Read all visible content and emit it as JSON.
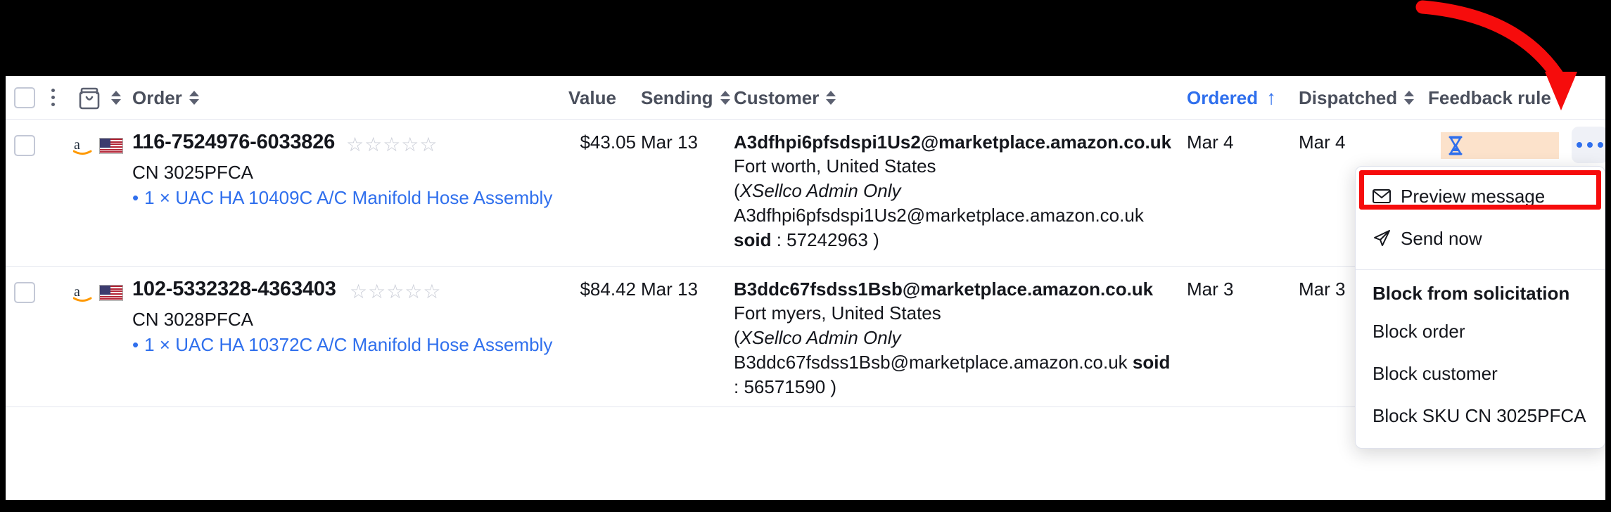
{
  "app": {
    "accent_blue": "#2f6fed",
    "highlight_red": "#f60c0c",
    "badge_peach": "#fce2cb"
  },
  "table": {
    "headers": {
      "checkbox": "",
      "kebab": "",
      "bag_icon": "shopping-bag-icon",
      "order": "Order",
      "value": "Value",
      "sending": "Sending",
      "customer": "Customer",
      "ordered": "Ordered",
      "dispatched": "Dispatched",
      "feedback_rule": "Feedback rule"
    },
    "sort": {
      "active_column": "Ordered",
      "direction": "↑"
    },
    "rows": [
      {
        "marketplace_icon": "amazon-icon",
        "country_flag": "us-flag-icon",
        "order_number": "116-7524976-6033826",
        "stars": "☆☆☆☆☆",
        "sku": "CN 3025PFCA",
        "item_line": "1 × UAC HA 10409C A/C Manifold Hose Assembly",
        "value": "$43.05",
        "sending": "Mar 13",
        "customer_email": "A3dfhpi6pfsdspi1Us2@marketplace.amazon.co.uk",
        "customer_location": "Fort worth, United States",
        "admin_note_open": "(",
        "admin_note_label": "XSellco Admin Only",
        "admin_detail_email": "A3dfhpi6pfsdspi1Us2@marketplace.amazon.co.uk",
        "soid_label": "soid",
        "soid_separator": ":",
        "soid_value": "57242963",
        "admin_note_close": ")",
        "ordered": "Mar 4",
        "dispatched": "Mar 4",
        "feedback_rule_icon": "hourglass-icon"
      },
      {
        "marketplace_icon": "amazon-icon",
        "country_flag": "us-flag-icon",
        "order_number": "102-5332328-4363403",
        "stars": "☆☆☆☆☆",
        "sku": "CN 3028PFCA",
        "item_line": "1 × UAC HA 10372C A/C Manifold Hose Assembly",
        "value": "$84.42",
        "sending": "Mar 13",
        "customer_email": "B3ddc67fsdss1Bsb@marketplace.amazon.co.uk",
        "customer_location": "Fort myers, United States",
        "admin_note_open": "(",
        "admin_note_label": "XSellco Admin Only",
        "admin_detail_email": "B3ddc67fsdss1Bsb@marketplace.amazon.co.uk",
        "soid_label": "soid",
        "soid_separator": ":",
        "soid_value": "56571590",
        "admin_note_close": ")",
        "ordered": "Mar 3",
        "dispatched": "Mar 3",
        "feedback_rule_icon": ""
      }
    ]
  },
  "context_menu": {
    "items": [
      {
        "label": "Preview message",
        "icon": "envelope-icon",
        "highlighted": true
      },
      {
        "label": "Send now",
        "icon": "send-paper-plane-icon",
        "highlighted": false
      }
    ],
    "section_title": "Block from solicitation",
    "block_items": [
      {
        "label": "Block order"
      },
      {
        "label": "Block customer"
      },
      {
        "label": "Block SKU CN 3025PFCA"
      }
    ]
  },
  "annotation": {
    "arrow": "red-curved-arrow-pointing-to-ellipsis-button"
  }
}
